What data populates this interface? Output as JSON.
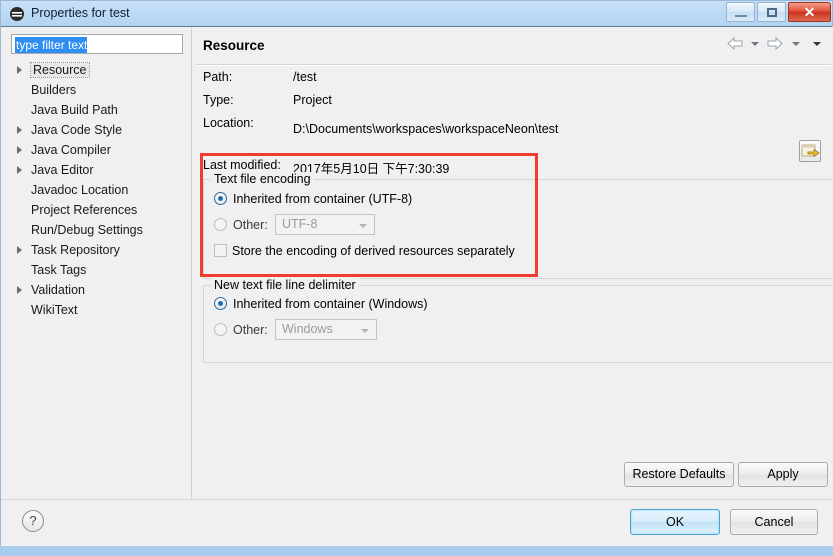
{
  "window": {
    "title": "Properties for test",
    "icon": "eclipse-icon",
    "controls": {
      "minimize": "–",
      "maximize": "□",
      "close": "✕"
    }
  },
  "sidebar": {
    "filter": {
      "value": "type filter text",
      "placeholder": "type filter text"
    },
    "items": [
      {
        "label": "Resource",
        "expandable": true,
        "selected": true
      },
      {
        "label": "Builders",
        "expandable": false,
        "selected": false
      },
      {
        "label": "Java Build Path",
        "expandable": false,
        "selected": false
      },
      {
        "label": "Java Code Style",
        "expandable": true,
        "selected": false
      },
      {
        "label": "Java Compiler",
        "expandable": true,
        "selected": false
      },
      {
        "label": "Java Editor",
        "expandable": true,
        "selected": false
      },
      {
        "label": "Javadoc Location",
        "expandable": false,
        "selected": false
      },
      {
        "label": "Project References",
        "expandable": false,
        "selected": false
      },
      {
        "label": "Run/Debug Settings",
        "expandable": false,
        "selected": false
      },
      {
        "label": "Task Repository",
        "expandable": true,
        "selected": false
      },
      {
        "label": "Task Tags",
        "expandable": false,
        "selected": false
      },
      {
        "label": "Validation",
        "expandable": true,
        "selected": false
      },
      {
        "label": "WikiText",
        "expandable": false,
        "selected": false
      }
    ]
  },
  "page": {
    "title": "Resource",
    "nav": {
      "back": "back-arrow",
      "back_menu": "chevron-down-icon",
      "forward": "forward-arrow",
      "forward_menu": "chevron-down-icon",
      "view_menu": "chevron-down-icon"
    },
    "info": {
      "path_label": "Path:",
      "path_value": "/test",
      "type_label": "Type:",
      "type_value": "Project",
      "location_label": "Location:",
      "location_value": "D:\\Documents\\workspaces\\workspaceNeon\\test",
      "edit_location_button": "edit-location-icon",
      "last_modified_label": "Last modified:",
      "last_modified_value": "2017年5月10日 下午7:30:39"
    },
    "text_file_encoding": {
      "legend": "Text file encoding",
      "inherited_label": "Inherited from container (UTF-8)",
      "inherited_selected": true,
      "other_label": "Other:",
      "other_selected": false,
      "other_value": "UTF-8",
      "store_derived_label": "Store the encoding of derived resources separately",
      "store_derived_checked": false
    },
    "line_delimiter": {
      "legend": "New text file line delimiter",
      "inherited_label": "Inherited from container (Windows)",
      "inherited_selected": true,
      "other_label": "Other:",
      "other_selected": false,
      "other_value": "Windows"
    },
    "buttons": {
      "restore_defaults": "Restore Defaults",
      "apply": "Apply"
    }
  },
  "footer": {
    "help": "?",
    "ok": "OK",
    "cancel": "Cancel"
  },
  "annotation": {
    "color": "#f03c30",
    "shape": "rectangle"
  }
}
